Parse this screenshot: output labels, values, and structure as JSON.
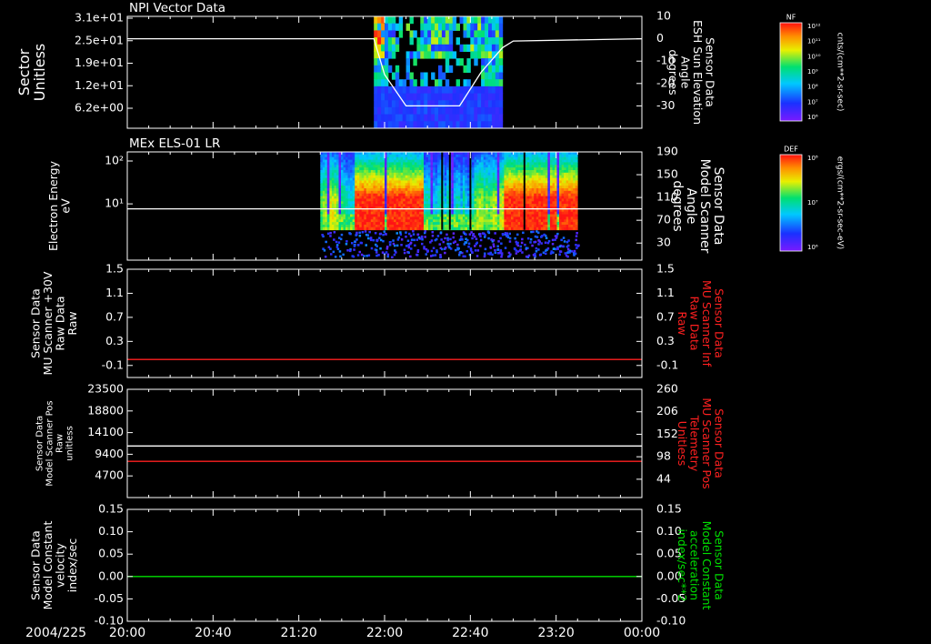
{
  "date_label": "2004/225",
  "time_ticks": [
    "20:00",
    "20:40",
    "21:20",
    "22:00",
    "22:40",
    "23:20",
    "00:00"
  ],
  "colors": {
    "background": "#000000",
    "axis": "#ffffff",
    "red_trace": "#ff2020",
    "green_trace": "#00e000",
    "white_trace": "#ffffff"
  },
  "chart_data": [
    {
      "id": "npi",
      "type": "heatmap",
      "title": "NPI Vector Data",
      "ylabel": [
        "Sector",
        "Unitless"
      ],
      "yticks": [
        "3.1e+01",
        "2.5e+01",
        "1.9e+01",
        "1.2e+01",
        "6.2e+00"
      ],
      "right_ylabel": [
        "Sensor Data",
        "ESH Sun Elevation",
        "Angle",
        "degrees"
      ],
      "right_yticks": [
        10,
        0,
        -10,
        -20,
        -30
      ],
      "right_ylim": [
        -40,
        10
      ],
      "data_time_range": [
        "21:55",
        "22:55"
      ],
      "overlay_line": {
        "axis": "right",
        "color": "#ffffff",
        "x": [
          "20:00",
          "21:55",
          "22:00",
          "22:10",
          "22:35",
          "22:45",
          "22:55",
          "23:00",
          "00:00"
        ],
        "y": [
          0,
          0,
          -16,
          -30,
          -30,
          -15,
          -4,
          -1,
          0
        ]
      },
      "colorbar": {
        "label": "NF",
        "ticks": [
          "10¹²",
          "10¹¹",
          "10¹⁰",
          "10⁹",
          "10⁸",
          "10⁷",
          "10⁶"
        ],
        "units": "cnts/(cm**2-sr-sec)"
      }
    },
    {
      "id": "els",
      "type": "heatmap",
      "title": "MEx ELS-01 LR",
      "ylabel": [
        "Electron Energy",
        "eV"
      ],
      "yticks": [
        "10²",
        "10¹"
      ],
      "yscale": "log",
      "right_ylabel": [
        "Sensor Data",
        "Model Scanner",
        "Angle",
        "degrees"
      ],
      "right_yticks": [
        190,
        150,
        110,
        70,
        30
      ],
      "right_ylim": [
        0,
        190
      ],
      "data_time_range": [
        "21:30",
        "23:30"
      ],
      "overlay_line": {
        "axis": "right",
        "color": "#ffffff",
        "value": 90
      },
      "colorbar": {
        "label": "DEF",
        "ticks": [
          "10⁸",
          "10⁷",
          "10⁶"
        ],
        "units": "ergs/(cm**2-sr-sec-eV)"
      }
    },
    {
      "id": "mu_raw",
      "type": "line",
      "ylabel": [
        "Sensor Data",
        "MU Scanner +30V",
        "Raw Data",
        "Raw"
      ],
      "yticks": [
        1.5,
        1.1,
        0.7,
        0.3,
        -0.1
      ],
      "ylim": [
        -0.3,
        1.5
      ],
      "right_ylabel": [
        "Sensor Data",
        "MU Scanner Inf",
        "Raw Data",
        "Raw"
      ],
      "right_yticks": [
        1.5,
        1.1,
        0.7,
        0.3,
        -0.1
      ],
      "right_ylim": [
        -0.3,
        1.5
      ],
      "series": [
        {
          "axis": "right",
          "color": "#ff2020",
          "value": 0.0
        }
      ]
    },
    {
      "id": "scanner_pos",
      "type": "line",
      "ylabel": [
        "Sensor Data",
        "Model Scanner Pos",
        "Raw",
        "unitless"
      ],
      "yticks": [
        23500,
        18800,
        14100,
        9400,
        4700
      ],
      "ylim": [
        0,
        23500
      ],
      "right_ylabel": [
        "Sensor Data",
        "MU Scanner Pos",
        "Telemetry",
        "Unitless"
      ],
      "right_yticks": [
        260,
        206,
        152,
        98,
        44
      ],
      "right_ylim": [
        0,
        260
      ],
      "series": [
        {
          "axis": "left",
          "color": "#ffffff",
          "value": 11200
        },
        {
          "axis": "right",
          "color": "#ff2020",
          "value": 87
        }
      ]
    },
    {
      "id": "velocity",
      "type": "line",
      "ylabel": [
        "Sensor Data",
        "Model Constant",
        "velocity",
        "index/sec"
      ],
      "yticks": [
        "0.15",
        "0.10",
        "0.05",
        "0.00",
        "-0.05",
        "-0.10"
      ],
      "ylim": [
        -0.1,
        0.15
      ],
      "right_ylabel": [
        "Sensor Data",
        "Model Constant",
        "acceleration",
        "index/sec**2"
      ],
      "right_yticks": [
        "0.15",
        "0.10",
        "0.05",
        "0.00",
        "-0.05",
        "-0.10"
      ],
      "right_ylim": [
        -0.1,
        0.15
      ],
      "series": [
        {
          "axis": "left",
          "color": "#00e000",
          "value": 0.0
        }
      ]
    }
  ]
}
